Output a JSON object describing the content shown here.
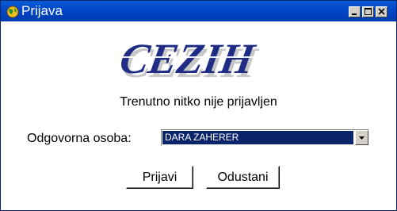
{
  "window": {
    "title": "Prijava",
    "icon": "globe-icon",
    "controls": [
      "minimize-icon",
      "maximize-icon",
      "close-icon"
    ]
  },
  "logo": {
    "text": "CEZIH"
  },
  "status_text": "Trenutno nitko nije prijavljen",
  "form": {
    "label": "Odgovorna osoba:",
    "selected_value": "DARA ZAHERER"
  },
  "buttons": {
    "login": "Prijavi",
    "cancel": "Odustani"
  },
  "colors": {
    "titlebar": "#0047c8",
    "selection": "#0a246a",
    "logo_blue": "#1f2d86"
  }
}
